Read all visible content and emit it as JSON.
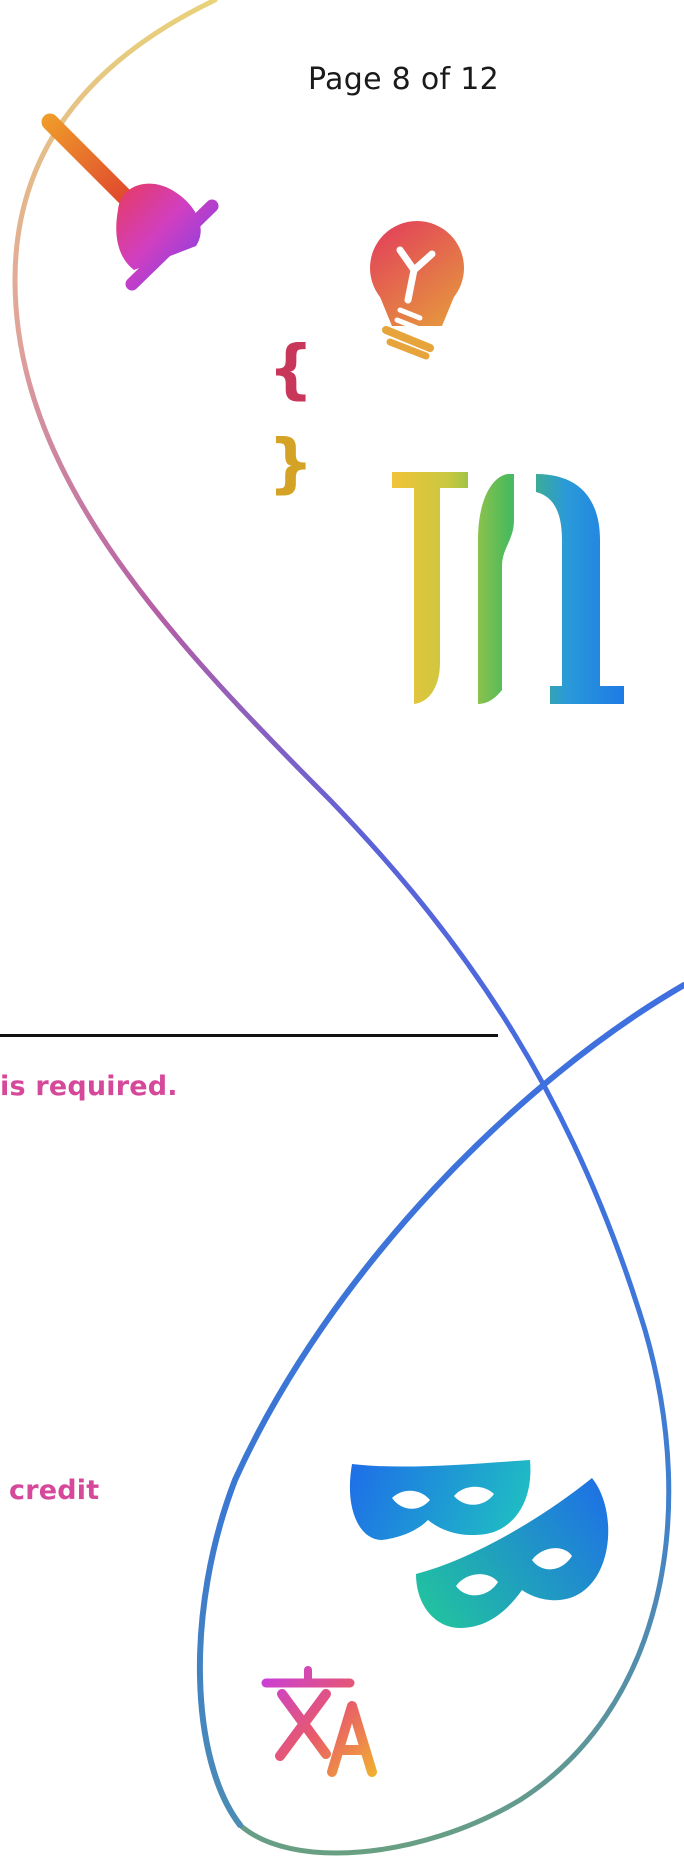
{
  "header": {
    "page_number": "Page 8 of 12"
  },
  "content": {
    "fragment_1": "is required.",
    "fragment_2": "credit"
  },
  "icons": [
    "plunger-icon",
    "lightbulb-icon",
    "braces-icon",
    "stencil-letters-icon",
    "masks-icon",
    "translate-icon"
  ],
  "colors": {
    "text_accent": "#d6489a",
    "rule": "#111111",
    "page_number": "#1a1a1a",
    "curve_start": "#e8d27a",
    "curve_mid": "#9b56b8",
    "curve_blue": "#3f6fe0",
    "curve_end": "#6aa080"
  }
}
